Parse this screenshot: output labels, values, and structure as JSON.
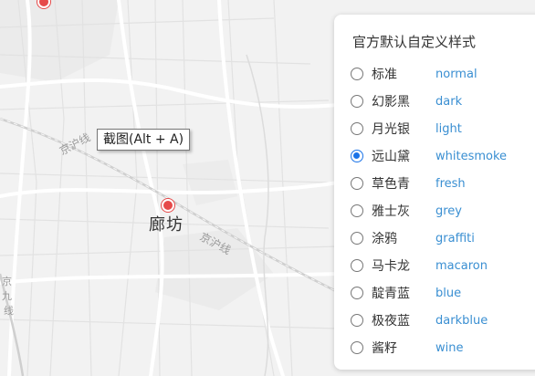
{
  "map": {
    "city_label": "廊坊",
    "road_labels": [
      "京沪线",
      "京沪线",
      "京",
      "九",
      "线"
    ]
  },
  "tooltip": {
    "text": "截图(Alt + A)"
  },
  "style_panel": {
    "title": "官方默认自定义样式",
    "selected": "whitesmoke",
    "options": [
      {
        "cn": "标准",
        "en": "normal"
      },
      {
        "cn": "幻影黑",
        "en": "dark"
      },
      {
        "cn": "月光银",
        "en": "light"
      },
      {
        "cn": "远山黛",
        "en": "whitesmoke"
      },
      {
        "cn": "草色青",
        "en": "fresh"
      },
      {
        "cn": "雅士灰",
        "en": "grey"
      },
      {
        "cn": "涂鸦",
        "en": "graffiti"
      },
      {
        "cn": "马卡龙",
        "en": "macaron"
      },
      {
        "cn": "靛青蓝",
        "en": "blue"
      },
      {
        "cn": "极夜蓝",
        "en": "darkblue"
      },
      {
        "cn": "酱籽",
        "en": "wine"
      }
    ]
  },
  "colors": {
    "accent": "#1a73e8",
    "english_label": "#3a8fd2",
    "poi": "#e64a4a"
  }
}
